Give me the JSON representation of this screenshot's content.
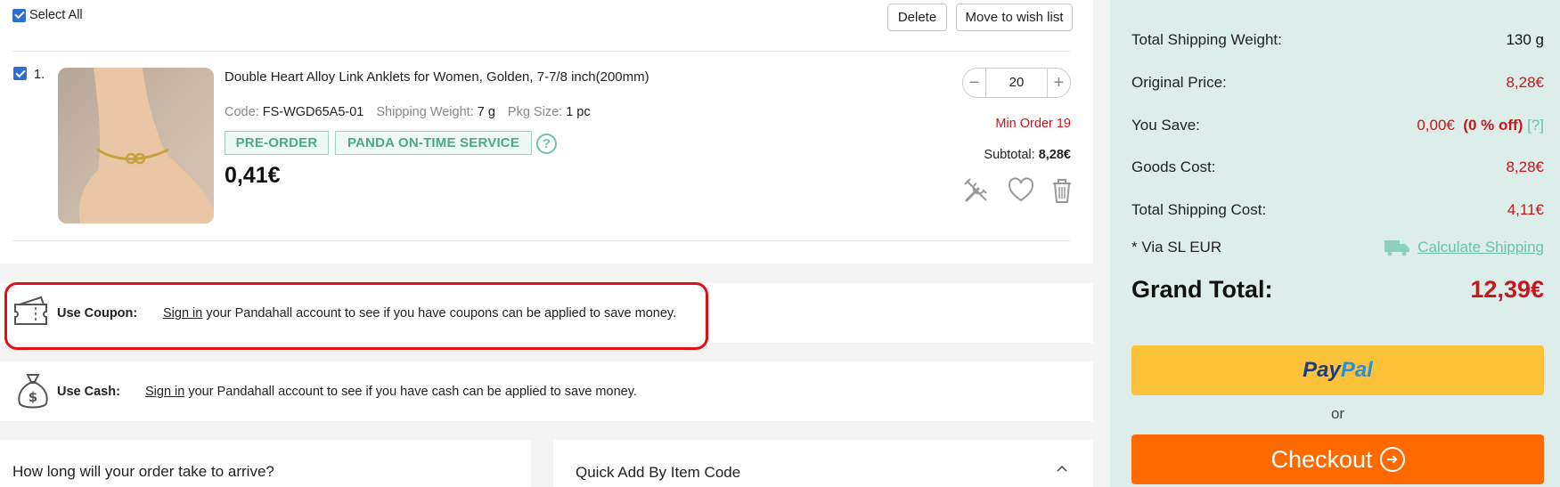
{
  "cart": {
    "select_all_label": "Select All",
    "delete_label": "Delete",
    "wishlist_label": "Move to wish list"
  },
  "item": {
    "index": "1.",
    "title": "Double Heart Alloy Link Anklets for Women, Golden, 7-7/8 inch(200mm)",
    "code_label": "Code:",
    "code": "FS-WGD65A5-01",
    "weight_label": "Shipping Weight:",
    "weight": "7 g",
    "pkg_label": "Pkg Size:",
    "pkg": "1 pc",
    "tag_preorder": "PRE-ORDER",
    "tag_service": "PANDA ON-TIME SERVICE",
    "help": "?",
    "price": "0,41€",
    "quantity": "20",
    "minus": "−",
    "plus": "+",
    "min_order": "Min Order 19",
    "subtotal_label": "Subtotal:",
    "subtotal": "8,28€"
  },
  "coupon": {
    "label": "Use Coupon:",
    "sign_in": "Sign in",
    "text": " your Pandahall account to see if you have coupons can be applied to save money."
  },
  "cash": {
    "label": "Use Cash:",
    "sign_in": "Sign in",
    "text": " your Pandahall account to see if you have cash can be applied to save money."
  },
  "faq": {
    "title": "How long will your order take to arrive?"
  },
  "quick_add": {
    "title": "Quick Add By Item Code"
  },
  "summary": {
    "weight_label": "Total Shipping Weight:",
    "weight": "130  g",
    "orig_label": "Original Price:",
    "orig": "8,28€",
    "save_label": "You Save:",
    "save": "0,00€",
    "save_pct": "(0 % off)",
    "save_help": "[?]",
    "goods_label": "Goods Cost:",
    "goods": "8,28€",
    "ship_label": "Total Shipping Cost:",
    "ship": "4,11€",
    "via": "* Via SL EUR",
    "calc": "Calculate Shipping",
    "grand_label": "Grand Total:",
    "grand": "12,39€",
    "paypal_a": "Pay",
    "paypal_b": "Pal",
    "or": "or",
    "checkout": "Checkout"
  },
  "colors": {
    "accent_red": "#c8161d",
    "teal": "#6cc3a7",
    "paypal_yellow": "#fcc23a",
    "checkout_orange": "#ff6a00",
    "highlight": "#e0101a"
  },
  "icons": {
    "coupon": "ticket-icon",
    "cash": "money-bag-icon",
    "tools": "tools-icon",
    "wish": "heart-icon",
    "trash": "trash-icon",
    "truck": "truck-icon",
    "chevron": "chevron-up-icon",
    "arrow": "arrow-right-circle-icon"
  }
}
